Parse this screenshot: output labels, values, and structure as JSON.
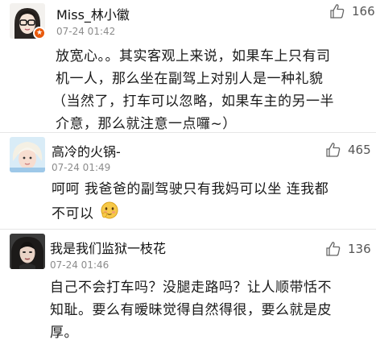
{
  "colors": {
    "badge": "#e8590c",
    "username": "#111111",
    "time": "#8c8c8c",
    "text": "#1a1a1a",
    "count": "#555555"
  },
  "comments": [
    {
      "username": "Miss_林小徽",
      "time": "07-24 01:42",
      "likes": "166",
      "badge_icon": "star-badge-icon",
      "text_lines": [
        "放宽心。。其实客观上来说，如果车上只有司",
        "机一人，那么坐在副驾上对别人是一种礼貌",
        "（当然了，打车可以忽略，如果车主的另一半",
        "介意，那么就注意一点囉~）"
      ]
    },
    {
      "username": "高冷的火锅-",
      "time": "07-24 01:49",
      "likes": "465",
      "text_lines": [
        "呵呵 我爸爸的副驾驶只有我妈可以坐 连我都",
        "不可以"
      ],
      "emoji_icon": "shy-face-emoji-icon"
    },
    {
      "username": "我是我们监狱一枝花",
      "time": "07-24 01:46",
      "likes": "136",
      "text_lines": [
        "自己不会打车吗？没腿走路吗？让人顺带恬不",
        "知耻。要么有暧昧觉得自然得很，要么就是皮",
        "厚。"
      ]
    }
  ]
}
